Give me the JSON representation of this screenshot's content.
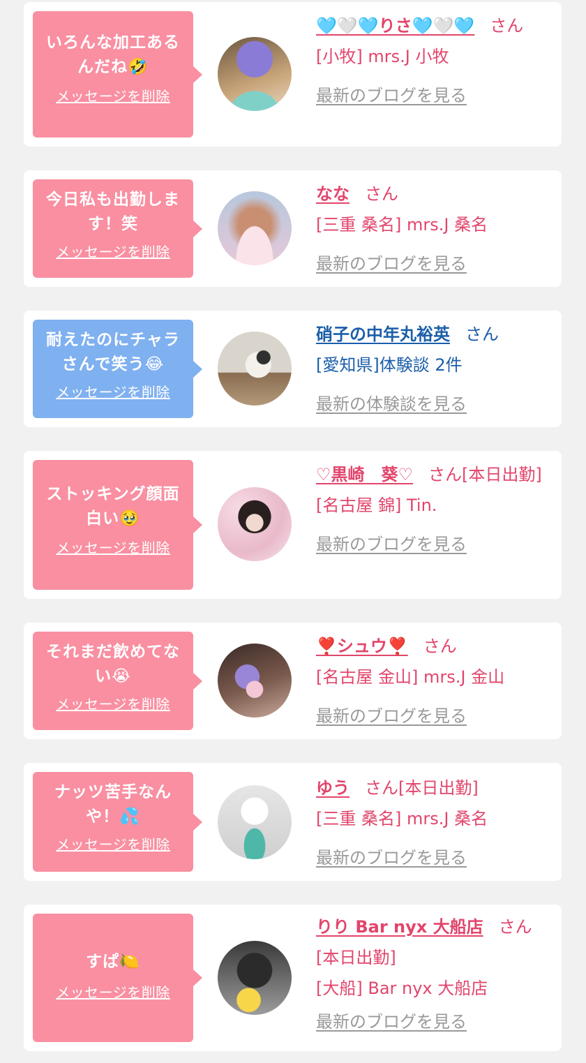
{
  "messages": [
    {
      "message": "いろんな加工あるんだね🤣",
      "delete_label": "メッセージを削除",
      "name_line": "🩵🤍🩵りさ🩵🤍🩵",
      "honorific": "さん",
      "status": "",
      "location": "[小牧] mrs.J 小牧",
      "link": "最新のブログを見る",
      "theme": "pink"
    },
    {
      "message": "今日私も出勤します！笑",
      "delete_label": "メッセージを削除",
      "name_line": "なな",
      "honorific": "さん",
      "status": "",
      "location": "[三重 桑名] mrs.J 桑名",
      "link": "最新のブログを見る",
      "theme": "pink"
    },
    {
      "message": "耐えたのにチャラさんで笑う😂",
      "delete_label": "メッセージを削除",
      "name_line": "硝子の中年丸裕英",
      "honorific": "さん",
      "status": "",
      "location": "[愛知県]体験談 2件",
      "link": "最新の体験談を見る",
      "theme": "blue"
    },
    {
      "message": "ストッキング顔面白い🥹",
      "delete_label": "メッセージを削除",
      "name_line": "♡黒崎　葵♡",
      "honorific": "さん",
      "status": "[本日出勤]",
      "location": "[名古屋 錦] Tin.",
      "link": "最新のブログを見る",
      "theme": "pink"
    },
    {
      "message": "それまだ飲めてない😭",
      "delete_label": "メッセージを削除",
      "name_line": "❣️シュウ❣️",
      "honorific": "さん",
      "status": "",
      "location": "[名古屋 金山] mrs.J 金山",
      "link": "最新のブログを見る",
      "theme": "pink"
    },
    {
      "message": "ナッツ苦手なんや！💦",
      "delete_label": "メッセージを削除",
      "name_line": "ゆう",
      "honorific": "さん",
      "status": "[本日出勤]",
      "location": "[三重 桑名] mrs.J 桑名",
      "link": "最新のブログを見る",
      "theme": "pink"
    },
    {
      "message": "すぱ🍋",
      "delete_label": "メッセージを削除",
      "name_line": "りり Bar nyx 大船店",
      "honorific": "さん",
      "status": "[本日出勤]",
      "location": "[大船] Bar nyx 大船店",
      "link": "最新のブログを見る",
      "theme": "pink"
    }
  ]
}
